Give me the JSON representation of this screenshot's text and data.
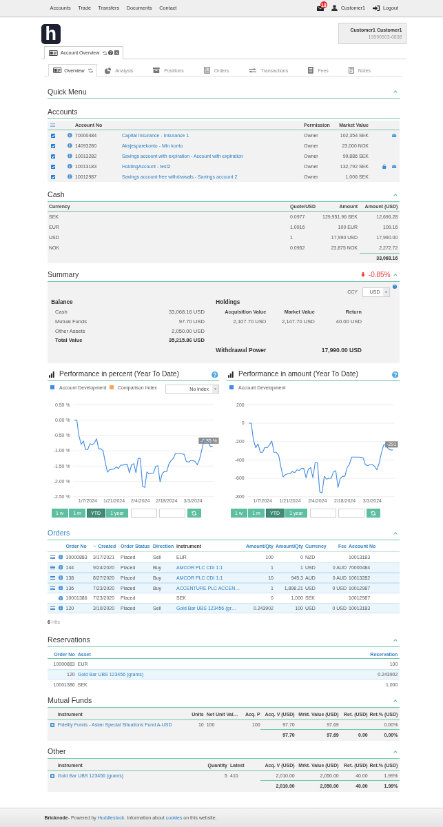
{
  "top_nav": {
    "links": [
      "Accounts",
      "Trade",
      "Transfers",
      "Documents",
      "Contact"
    ],
    "message_count": "18",
    "user": "Customer1",
    "logout": "Logout"
  },
  "logo": {
    "letter": "h"
  },
  "customer": {
    "name": "Customer1 Customer1",
    "id": "19590503-0838"
  },
  "page_tab": {
    "label": "Account Overview"
  },
  "tabs": [
    {
      "label": "Overview",
      "selected": true
    },
    {
      "label": "Analysis",
      "selected": false
    },
    {
      "label": "Positions",
      "selected": false
    },
    {
      "label": "Orders",
      "selected": false
    },
    {
      "label": "Transactions",
      "selected": false
    },
    {
      "label": "Fees",
      "selected": false
    },
    {
      "label": "Notes",
      "selected": false
    }
  ],
  "quick_menu": {
    "title": "Quick Menu",
    "expanded": true
  },
  "accounts": {
    "title": "Accounts",
    "columns": {
      "account_no": "Account No",
      "permission": "Permission",
      "market_value": "Market Value"
    },
    "rows": [
      {
        "checked": true,
        "account_no": "70000484",
        "name": "Capital Insurance - Insurance 1",
        "permission": "Owner",
        "market_value": "102,354 SEK",
        "locked": false,
        "portfolio": true
      },
      {
        "checked": true,
        "account_no": "14093280",
        "name": "Aksjesparekonto - Min konto",
        "permission": "Owner",
        "market_value": "23,000 NOK",
        "locked": false,
        "portfolio": false
      },
      {
        "checked": true,
        "account_no": "10013282",
        "name": "Savings account with expiration - Account with expiration",
        "permission": "Owner",
        "market_value": "99,886 SEK",
        "locked": false,
        "portfolio": false
      },
      {
        "checked": true,
        "account_no": "10013183",
        "name": "HoldingAccount - test2",
        "permission": "Owner",
        "market_value": "132,792 SEK",
        "locked": true,
        "portfolio": true
      },
      {
        "checked": true,
        "account_no": "10012987",
        "name": "Savings account free withdrawals - Savings account 2",
        "permission": "Owner",
        "market_value": "1,006 SEK",
        "locked": false,
        "portfolio": false
      }
    ]
  },
  "cash": {
    "title": "Cash",
    "expanded": true,
    "columns": [
      "Currency",
      "Quote/USD",
      "Amount",
      "Amount (USD)"
    ],
    "rows": [
      [
        "SEK",
        "0.0977",
        "129,951.96 SEK",
        "12,696.28"
      ],
      [
        "EUR",
        "1.0916",
        "100 EUR",
        "109.16"
      ],
      [
        "USD",
        "1",
        "17,990 USD",
        "17,990.00"
      ],
      [
        "NOK",
        "0.0952",
        "23,875 NOK",
        "2,272.72"
      ]
    ],
    "total": "33,068.16"
  },
  "summary": {
    "title": "Summary",
    "expanded": true,
    "change": {
      "negative": true,
      "text": "-0.85%"
    },
    "ccy_label": "CCY",
    "ccy": "USD",
    "balance": {
      "title": "Balance",
      "rows": [
        {
          "label": "Cash",
          "value": "33,068.16 USD",
          "total": false
        },
        {
          "label": "Mutual Funds",
          "value": "97.70 USD",
          "total": false
        },
        {
          "label": "Other Assets",
          "value": "2,050.00 USD",
          "total": false
        },
        {
          "label": "Total Value",
          "value": "35,215.86 USD",
          "total": true
        }
      ]
    },
    "holdings": {
      "title": "Holdings",
      "columns": [
        {
          "label": "Acquisition Value",
          "value": "2,107.70 USD"
        },
        {
          "label": "Market Value",
          "value": "2,147.70 USD"
        },
        {
          "label": "Return",
          "value": "40.00 USD"
        }
      ]
    },
    "withdrawal": {
      "label": "Withdrawal Power",
      "value": "17,990.00 USD"
    }
  },
  "charts": [
    {
      "title": "Performance in percent (Year To Date)",
      "comparison": {
        "label": "Comparison Index",
        "color": "#f7a35c"
      },
      "index_select": "No index",
      "chart_data": {
        "type": "line",
        "grid": true,
        "categories": [
          null,
          null,
          null,
          null,
          null,
          null,
          "1/7/2024",
          null,
          null,
          null,
          null,
          null,
          null,
          null,
          null,
          null,
          null,
          null,
          "1/21/2024",
          null,
          null,
          null,
          null,
          null,
          null,
          null,
          null,
          null,
          null,
          null,
          "2/4/2024",
          null,
          null,
          null,
          null,
          null,
          null,
          null,
          null,
          null,
          null,
          null,
          "2/18/2024",
          null,
          null,
          null,
          null,
          null,
          null,
          null,
          null,
          null,
          null,
          null,
          "3/3/2024",
          null,
          null,
          null,
          null,
          null,
          null,
          null,
          null,
          null
        ],
        "series": [
          {
            "name": "Account Development",
            "color": "#3f8ae6",
            "values": [
              0,
              0,
              -0.52,
              -0.79,
              -0.68,
              -0.96,
              -0.96,
              -0.77,
              -0.81,
              -0.75,
              -0.61,
              -0.94,
              -0.94,
              -1,
              -1.39,
              -1.7,
              -1.62,
              -1.6,
              -1.6,
              -1.53,
              -1.58,
              -1.47,
              -1.47,
              -1.44,
              -1.44,
              -1.72,
              -1.46,
              -1.42,
              -1.72,
              -1.25,
              -1.25,
              -2.16,
              -2.2,
              -1.69,
              -1.76,
              -1.73,
              -1.73,
              -1.51,
              -1.49,
              -2.02,
              -1.74,
              -1.68,
              -1.68,
              -1.44,
              -1.32,
              -1.25,
              -1.09,
              -1.09,
              -1.09,
              -1.1,
              -1.12,
              -1.35,
              -1.37,
              -1.32,
              -1.32,
              -1.35,
              -1.46,
              -1.28,
              -0.98,
              -0.68,
              -0.68,
              -0.72,
              -0.87,
              -0.85
            ]
          }
        ],
        "ylim": [
          -2.5,
          0.5
        ],
        "yticks": [
          {
            "value": 0.5,
            "label": "0.50 %"
          },
          {
            "value": 0,
            "label": "0.00 %"
          },
          {
            "value": -0.5,
            "label": "-0.50 %"
          },
          {
            "value": -1,
            "label": "-1.00 %"
          },
          {
            "value": -1.5,
            "label": "-1.50 %"
          },
          {
            "value": -2,
            "label": "-2.00 %"
          },
          {
            "value": -2.5,
            "label": "-2.50 %"
          }
        ],
        "annotations": [
          {
            "y": -0.85,
            "text": "-0.85 %"
          }
        ]
      },
      "ranges": [
        {
          "label": "1 w",
          "selected": false
        },
        {
          "label": "1 m",
          "selected": false
        },
        {
          "label": "YTD",
          "selected": true
        },
        {
          "label": "1 year",
          "selected": false
        }
      ]
    },
    {
      "title": "Performance in amount (Year To Date)",
      "chart_data": {
        "type": "line",
        "grid": true,
        "categories": [
          null,
          null,
          null,
          null,
          null,
          null,
          "1/7/2024",
          null,
          null,
          null,
          null,
          null,
          null,
          null,
          null,
          null,
          null,
          null,
          "1/21/2024",
          null,
          null,
          null,
          null,
          null,
          null,
          null,
          null,
          null,
          null,
          null,
          "2/4/2024",
          null,
          null,
          null,
          null,
          null,
          null,
          null,
          null,
          null,
          null,
          null,
          "2/18/2024",
          null,
          null,
          null,
          null,
          null,
          null,
          null,
          null,
          null,
          null,
          null,
          "3/3/2024",
          null,
          null,
          null,
          null,
          null,
          null,
          null,
          null,
          null
        ],
        "series": [
          {
            "name": "Account Development",
            "color": "#3f8ae6",
            "values": [
              0,
              0,
              -185,
              -268,
              -225,
              -317,
              -317,
              -262,
              -268,
              -237,
              -194,
              -317,
              -317,
              -348,
              -477,
              -585,
              -560,
              -551,
              -551,
              -526,
              -538,
              -508,
              -514,
              -492,
              -492,
              -594,
              -502,
              -483,
              -594,
              -431,
              -431,
              -748,
              -760,
              -578,
              -609,
              -600,
              -600,
              -529,
              -517,
              -698,
              -600,
              -578,
              -578,
              -483,
              -446,
              -369,
              -369,
              -369,
              -369,
              -372,
              -378,
              -452,
              -462,
              -452,
              -452,
              -468,
              -508,
              -437,
              -323,
              -237,
              -237,
              -277,
              -292,
              -291
            ]
          }
        ],
        "ylim": [
          -800,
          200
        ],
        "yticks": [
          {
            "value": 200,
            "label": "200"
          },
          {
            "value": 0,
            "label": "0"
          },
          {
            "value": -200,
            "label": "-200"
          },
          {
            "value": -400,
            "label": "-400"
          },
          {
            "value": -600,
            "label": "-600"
          },
          {
            "value": -800,
            "label": "-800"
          }
        ],
        "annotations": [
          {
            "y": -291,
            "text": "-291"
          }
        ]
      },
      "ranges": [
        {
          "label": "1 w",
          "selected": false
        },
        {
          "label": "1 m",
          "selected": false
        },
        {
          "label": "YTD",
          "selected": true
        },
        {
          "label": "1 year",
          "selected": false
        }
      ]
    }
  ],
  "orders": {
    "title": "Orders",
    "title_link": true,
    "expanded": true,
    "columns": [
      {
        "label": "Order No",
        "sortable": true,
        "sorted": false
      },
      {
        "label": "Created",
        "sortable": true,
        "sorted": true
      },
      {
        "label": "Order Status",
        "sortable": true,
        "sorted": false
      },
      {
        "label": "Direction",
        "sortable": true,
        "sorted": false
      },
      {
        "label": "Instrument",
        "sortable": false,
        "sorted": false
      },
      {
        "label": "Amount/Qty",
        "sortable": true,
        "sorted": false
      },
      {
        "label": "Amount/Qty",
        "sortable": true,
        "sorted": false
      },
      {
        "label": "Currency",
        "sortable": true,
        "sorted": false
      },
      {
        "label": "Fee",
        "sortable": true,
        "sorted": false
      },
      {
        "label": "Account No",
        "sortable": true,
        "sorted": false
      }
    ],
    "rows": [
      {
        "menu": true,
        "kind": "cash",
        "order_no": "10000883",
        "created": "3/17/2021",
        "status": "Placed",
        "direction": "Sell",
        "instrument": "EUR",
        "amount": "100",
        "amount_2": "0",
        "currency": "NZD",
        "account_no": "10013183"
      },
      {
        "menu": true,
        "kind": "security",
        "order_no": "144",
        "created": "9/24/2020",
        "status": "Placed",
        "direction": "Buy",
        "instrument": "AMCOR PLC CDI 1:1",
        "amount": "1",
        "amount_2": "1",
        "currency": "USD",
        "fee": "0 AUD",
        "account_no": "70000484"
      },
      {
        "menu": true,
        "kind": "security",
        "order_no": "138",
        "created": "8/27/2020",
        "status": "Placed",
        "direction": "Buy",
        "instrument": "AMCOR PLC CDI 1:1",
        "amount": "10",
        "amount_2": "945.3",
        "currency": "AUD",
        "fee": "0 AUD",
        "account_no": "10013282"
      },
      {
        "menu": true,
        "kind": "security",
        "order_no": "136",
        "created": "7/23/2020",
        "status": "Placed",
        "direction": "Buy",
        "instrument": "ACCENTURE PLC ACCEN…",
        "amount": "1",
        "amount_2": "1,898.21",
        "currency": "USD",
        "fee": "0 USD",
        "account_no": "10012987"
      },
      {
        "menu": false,
        "kind": "cash",
        "order_no": "10001386",
        "created": "7/23/2020",
        "status": "Placed",
        "instrument": "SEK",
        "amount": "0",
        "amount_2": "1,000",
        "currency": "SEK",
        "account_no": "10012987"
      },
      {
        "menu": true,
        "kind": "security",
        "order_no": "120",
        "created": "3/10/2020",
        "status": "Placed",
        "direction": "Sell",
        "instrument": "Gold Bar UBS 123456 (gr…",
        "amount": "0.243902",
        "amount_2": "100",
        "currency": "USD",
        "fee": "0 USD",
        "account_no": "10013183"
      }
    ],
    "hits": "**6** Hits"
  },
  "reservations": {
    "title": "Reservations",
    "expanded": true,
    "columns": [
      "Order No",
      "Asset",
      "Reservation"
    ],
    "rows": [
      {
        "kind": "cash",
        "order_no": "10000883",
        "asset": "EUR",
        "reservation": "100"
      },
      {
        "kind": "security",
        "order_no": "120",
        "asset": "Gold Bar UBS 123456 (grams)",
        "reservation": "0.243902"
      },
      {
        "kind": "cash",
        "order_no": "10001386",
        "asset": "SEK",
        "reservation": "1,000"
      }
    ]
  },
  "mutual_funds": {
    "title": "Mutual Funds",
    "expanded": true,
    "columns": [
      "Instrument",
      "Units",
      "Net Unit Val…",
      "Acq. P",
      "Acq. V (USD)",
      "Mrkt. Value (USD)",
      "Ret. (USD)",
      "Ret.% (USD)"
    ],
    "rows": [
      [
        "Fidelity Funds - Asian Special Situations Fund A-USD",
        "10",
        "100",
        "100",
        "97.70",
        "97.69",
        null,
        "0.00%"
      ]
    ],
    "totals": [
      "97.70",
      "97.69",
      "0.00",
      "0.00%"
    ]
  },
  "other": {
    "title": "Other",
    "expanded": true,
    "columns": [
      "Instrument",
      "Quantity",
      "Latest",
      "Acq. V (USD)",
      "Mrkt. Value (USD)",
      "Ret. (USD)",
      "Ret.% (USD)"
    ],
    "rows": [
      [
        "Gold Bar UBS 123456 (grams)",
        "5",
        "410",
        "2,010.00",
        "2,050.00",
        "40.00",
        "1.99%"
      ]
    ],
    "totals": [
      "2,010.00",
      "2,050.00",
      "40.00",
      "1.99%"
    ]
  },
  "footer": {
    "parts": [
      {
        "kind": "bold",
        "text": "Bricknode"
      },
      {
        "kind": "text",
        "text": "- Powered by "
      },
      {
        "kind": "link",
        "text": "Huddlestock"
      },
      {
        "kind": "text",
        "text": ". Information about "
      },
      {
        "kind": "link",
        "text": "cookies"
      },
      {
        "kind": "text",
        "text": " on this website."
      }
    ]
  }
}
